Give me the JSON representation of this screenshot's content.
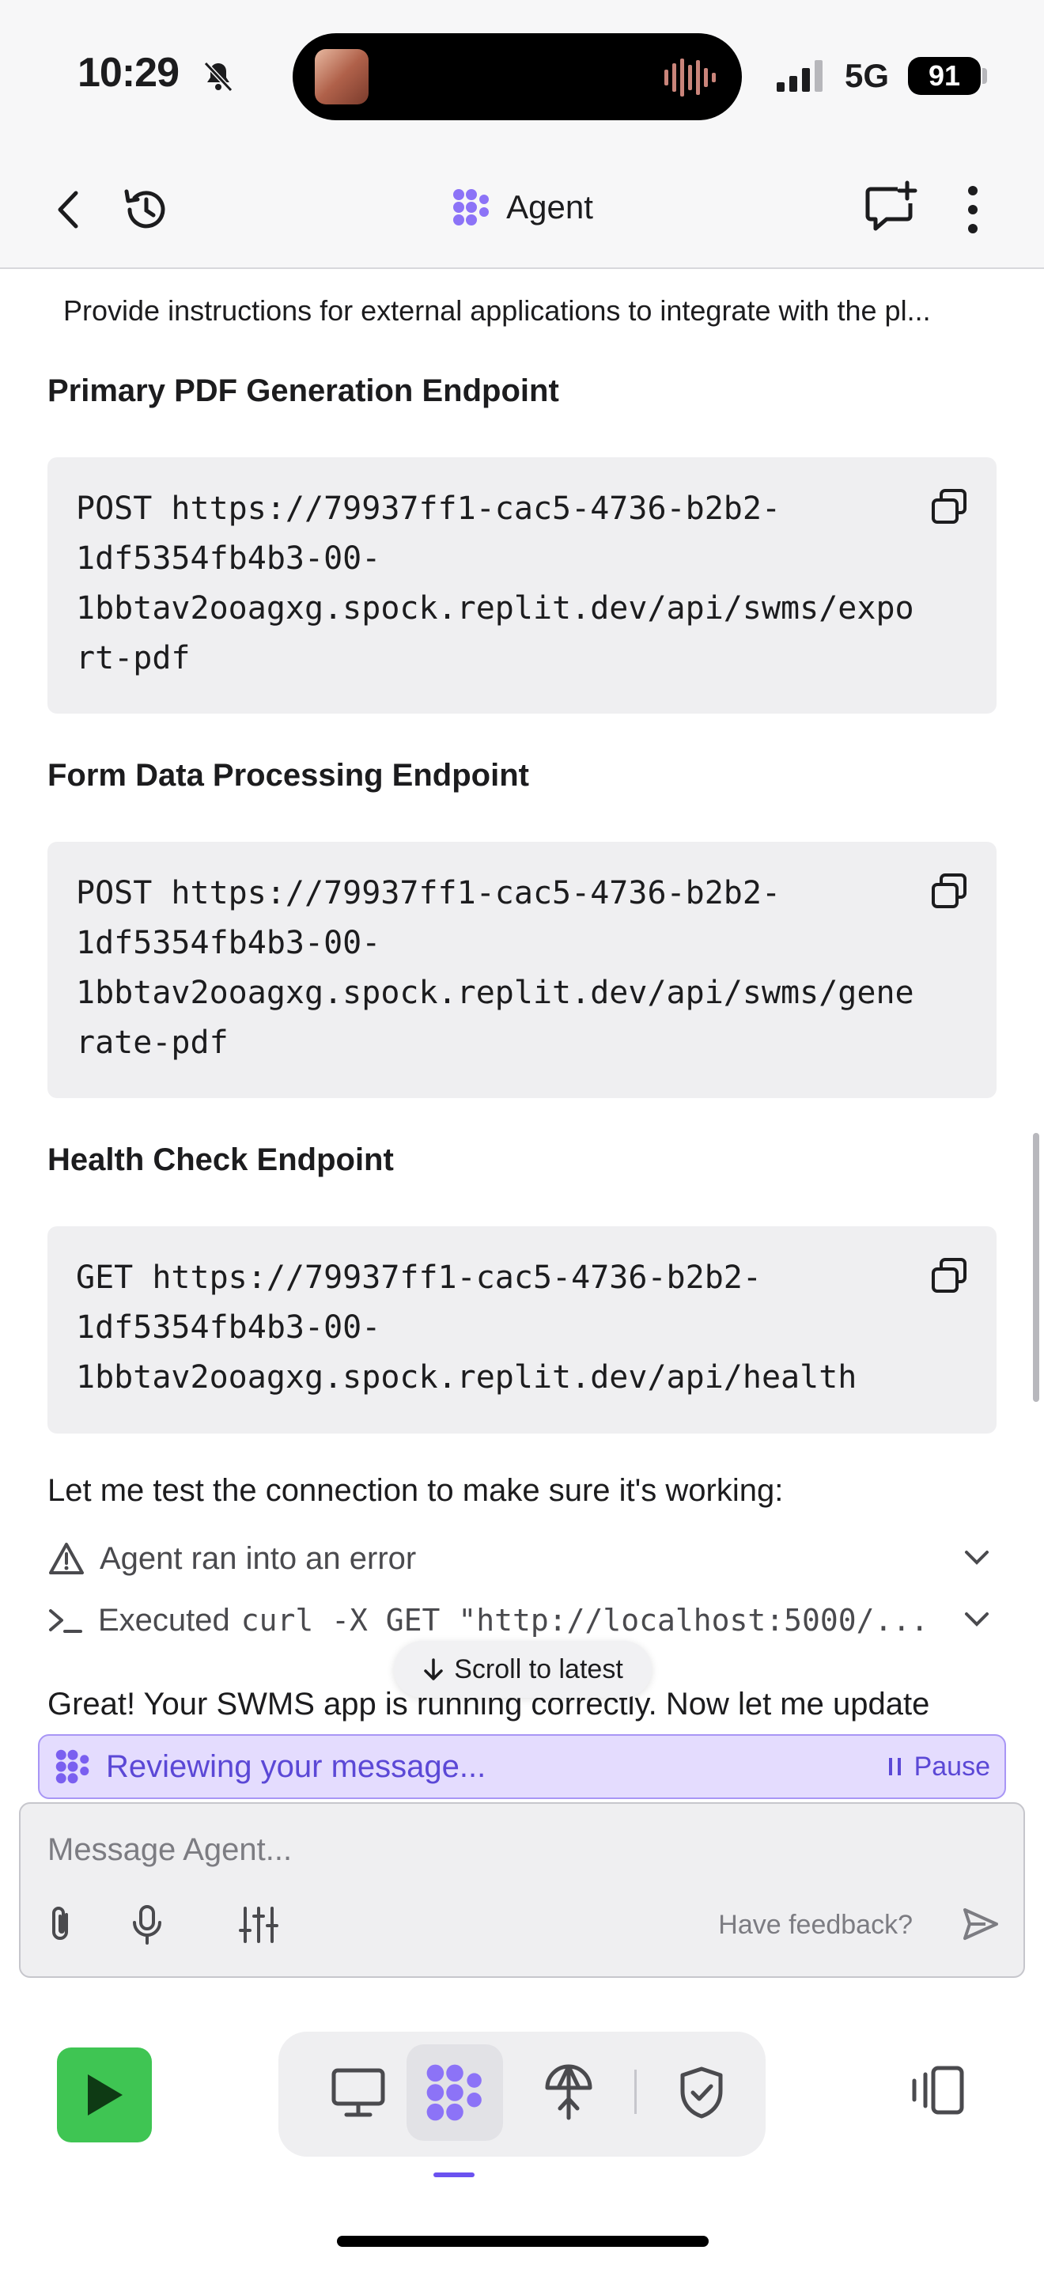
{
  "status": {
    "time": "10:29",
    "network": "5G",
    "battery": "91"
  },
  "header": {
    "title": "Agent"
  },
  "chat": {
    "prompt_preview": "Provide instructions for external applications to integrate with the pl...",
    "sections": [
      {
        "heading": "Primary PDF Generation Endpoint",
        "code": "POST https://79937ff1-cac5-4736-b2b2-\n1df5354fb4b3-00-\n1bbtav2ooagxg.spock.replit.dev/api/swms/expo\nrt-pdf"
      },
      {
        "heading": "Form Data Processing Endpoint",
        "code": "POST https://79937ff1-cac5-4736-b2b2-\n1df5354fb4b3-00-\n1bbtav2ooagxg.spock.replit.dev/api/swms/gene\nrate-pdf"
      },
      {
        "heading": "Health Check Endpoint",
        "code": "GET https://79937ff1-cac5-4736-b2b2-\n1df5354fb4b3-00-\n1bbtav2ooagxg.spock.replit.dev/api/health"
      }
    ],
    "test_line": "Let me test the connection to make sure it's working:",
    "error_row": "Agent ran into an error",
    "exec_prefix": "Executed",
    "exec_cmd": "curl -X GET \"http://localhost:5000/...",
    "scroll_label": "Scroll to latest",
    "partial_line": "Great! Your SWMS app is running correctly. Now let me update"
  },
  "reviewing": {
    "text": "Reviewing your message...",
    "pause": "Pause"
  },
  "composer": {
    "placeholder": "Message Agent...",
    "feedback": "Have feedback?"
  },
  "colors": {
    "accent": "#6b52f0",
    "run": "#3fc553",
    "reviewing_bg": "#e4dcfe"
  },
  "icons": [
    "back-icon",
    "history-icon",
    "agent-logo-icon",
    "new-chat-icon",
    "more-icon",
    "copy-icon",
    "warning-icon",
    "terminal-icon",
    "chevron-down-icon",
    "arrow-down-icon",
    "attach-icon",
    "mic-icon",
    "settings-sliders-icon",
    "send-icon",
    "play-icon",
    "desktop-icon",
    "agent-icon",
    "deploy-icon",
    "shield-icon",
    "layout-icon"
  ]
}
